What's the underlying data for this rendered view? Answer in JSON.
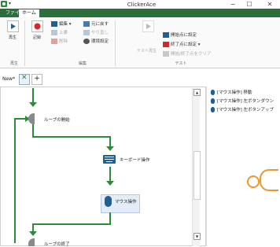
{
  "app": {
    "title": "ClickerAce",
    "qa_arrow": "▾"
  },
  "window": {
    "minimize": "−",
    "maximize": "☐",
    "close": "✕"
  },
  "ribbon_tabs": {
    "file": "ファイル",
    "home": "ホーム"
  },
  "ribbon": {
    "play": "再生",
    "record": "記録",
    "edit": {
      "label": "編集 ▾",
      "undo": "元に戻す",
      "overwrite": "上書",
      "redo": "やり直し",
      "delete": "削除",
      "env": "環境設定"
    },
    "test_play": "テスト再生",
    "test": {
      "set_start": "開始点に設定",
      "set_end": "終了点に設定 ▾",
      "clear": "開始/終了点をクリア"
    },
    "groups": {
      "play": "再生",
      "edit": "編集",
      "test": "テスト"
    }
  },
  "doc_tabs": {
    "new_label": "New*",
    "add": "+"
  },
  "flow": {
    "loop_start": "ループの開始",
    "key_op": "キーボード操作",
    "mouse_op": "マウス操作",
    "loop_end": "ループの終了"
  },
  "actions_list": [
    "[マウス操作] 移動",
    "[マウス操作] 左ボタンダウン",
    "[マウス操作] 左ボタンアップ"
  ],
  "colors": {
    "accent": "#2e8b3a",
    "ribbon_tab": "#2b6f3b",
    "mouse_icon": "#1f5f96",
    "cursor": "#e89a2c"
  }
}
